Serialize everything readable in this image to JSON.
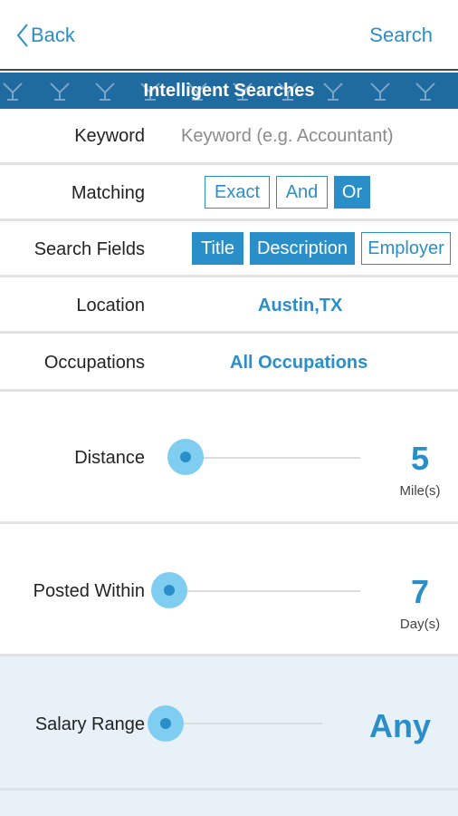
{
  "nav": {
    "back_label": "Back",
    "search_label": "Search"
  },
  "banner": {
    "title": "Intelligent Searches"
  },
  "form": {
    "keyword": {
      "label": "Keyword",
      "placeholder": "Keyword (e.g. Accountant)"
    },
    "matching": {
      "label": "Matching",
      "options": [
        {
          "label": "Exact",
          "selected": false
        },
        {
          "label": "And",
          "selected": false
        },
        {
          "label": "Or",
          "selected": true
        }
      ]
    },
    "search_fields": {
      "label": "Search Fields",
      "options": [
        {
          "label": "Title",
          "selected": true
        },
        {
          "label": "Description",
          "selected": true
        },
        {
          "label": "Employer",
          "selected": false
        }
      ]
    },
    "location": {
      "label": "Location",
      "value": "Austin,TX"
    },
    "occupations": {
      "label": "Occupations",
      "value": "All Occupations"
    },
    "distance": {
      "label": "Distance",
      "value": "5",
      "unit": "Mile(s)"
    },
    "posted_within": {
      "label": "Posted Within",
      "value": "7",
      "unit": "Day(s)"
    },
    "salary_range": {
      "label": "Salary Range",
      "value": "Any"
    }
  },
  "colors": {
    "accent": "#2a8fc9",
    "banner": "#1f6a9e",
    "knob": "#7fcdf0",
    "highlight_bg": "#e8f1f8"
  },
  "icons": {
    "back": "chevron-left-icon",
    "banner_pattern": "bird-icon"
  }
}
